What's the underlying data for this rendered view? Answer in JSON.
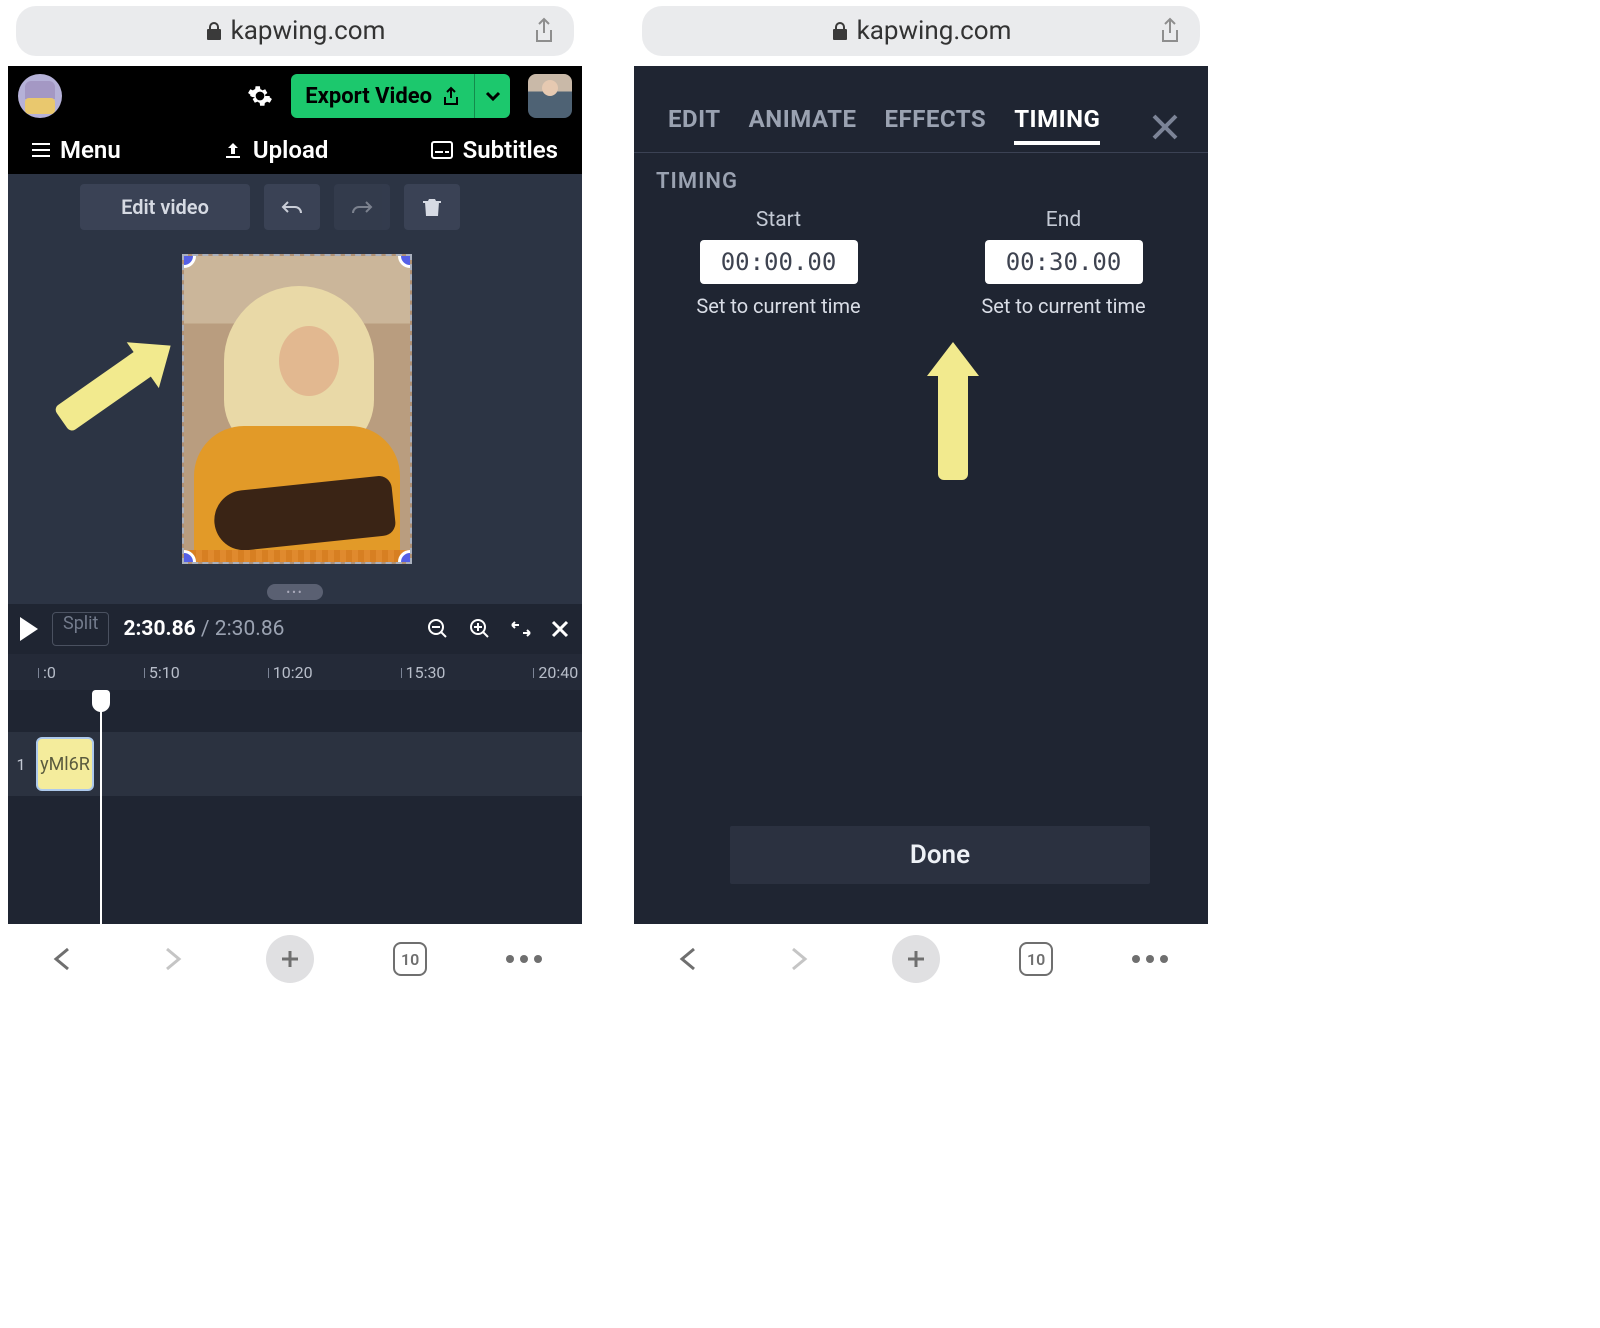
{
  "browser": {
    "domain": "kapwing.com",
    "tab_count": "10"
  },
  "left": {
    "header": {
      "export_label": "Export Video"
    },
    "nav": {
      "menu": "Menu",
      "upload": "Upload",
      "subtitles": "Subtitles"
    },
    "tools": {
      "edit_video": "Edit video"
    },
    "timeline": {
      "split": "Split",
      "current": "2:30.86",
      "duration": "2:30.86",
      "ruler": [
        ":0",
        "5:10",
        "10:20",
        "15:30",
        "20:40"
      ],
      "track_number": "1",
      "clip_name": "yMl6R"
    }
  },
  "right": {
    "tabs": {
      "edit": "EDIT",
      "animate": "ANIMATE",
      "effects": "EFFECTS",
      "timing": "TIMING"
    },
    "section_title": "TIMING",
    "start": {
      "label": "Start",
      "value": "00:00.00",
      "link": "Set to current time"
    },
    "end": {
      "label": "End",
      "value": "00:30.00",
      "link": "Set to current time"
    },
    "done": "Done"
  }
}
